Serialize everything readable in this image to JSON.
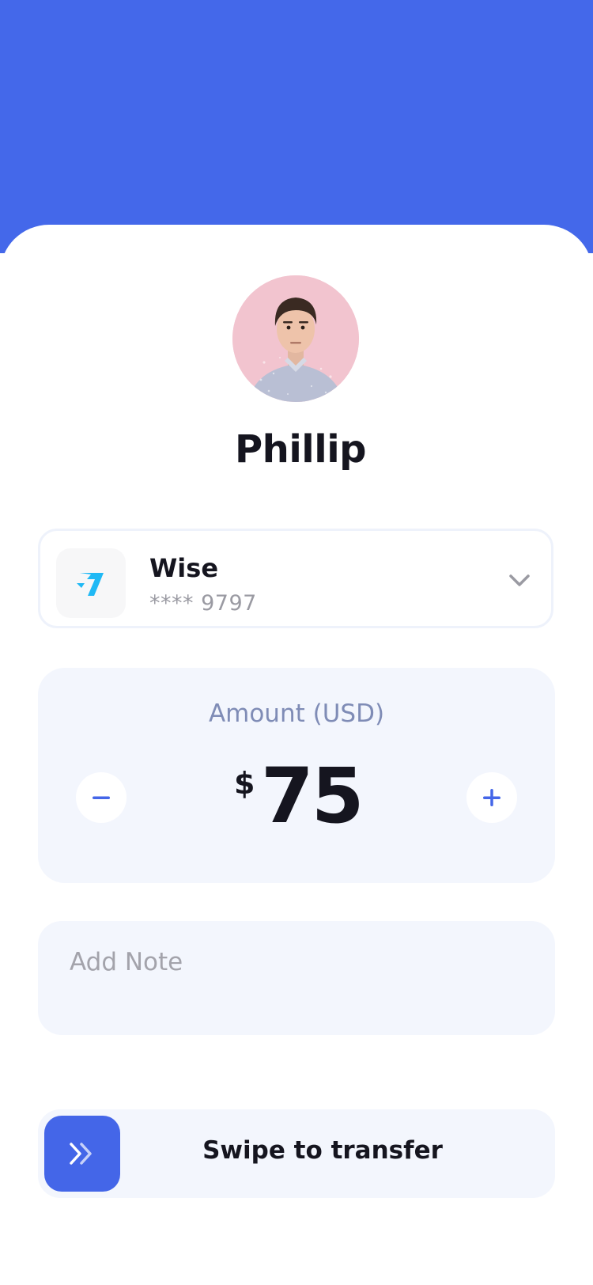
{
  "recipient": {
    "name": "Phillip",
    "avatar_alt": "Phillip avatar"
  },
  "account": {
    "bank_name": "Wise",
    "masked_number": "**** 9797",
    "logo_icon": "wise-logo-icon",
    "dropdown_icon": "chevron-down-icon"
  },
  "amount": {
    "label": "Amount (USD)",
    "currency_symbol": "$",
    "value": "75",
    "decrement_icon": "minus-icon",
    "increment_icon": "plus-icon"
  },
  "note": {
    "placeholder": "Add Note",
    "value": ""
  },
  "transfer": {
    "swipe_label": "Swipe to transfer",
    "handle_icon": "double-chevron-right-icon"
  },
  "colors": {
    "accent": "#4468ea",
    "card_bg": "#f3f6fd",
    "text_primary": "#15151f",
    "text_muted": "#9a9aa2",
    "label_blue": "#7f8cb6",
    "wise_logo": "#20b9f5"
  }
}
